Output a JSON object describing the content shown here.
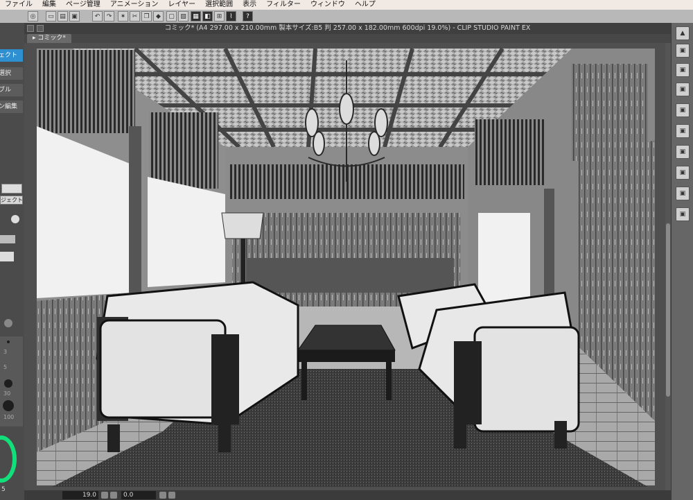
{
  "menubar": {
    "items": [
      "ファイル",
      "編集",
      "ページ管理",
      "アニメーション",
      "レイヤー",
      "選択範囲",
      "表示",
      "フィルター",
      "ウィンドウ",
      "ヘルプ"
    ]
  },
  "window": {
    "title": "コミック* (A4 297.00 x 210.00mm 製本サイズ:B5 判 257.00 x 182.00mm 600dpi 19.0%)  - CLIP STUDIO PAINT EX",
    "tab_label": "コミック*"
  },
  "toolbar": {
    "help_label": "?"
  },
  "left_panel": {
    "item1": "ェクト",
    "item2": "選択",
    "item3": "ブル",
    "item4": "ン編集",
    "field1": "ジェクト]",
    "brush_sizes": [
      "3",
      "5",
      "30",
      "100"
    ],
    "bottom_label": "5"
  },
  "status": {
    "zoom": "19.0",
    "angle": "0.0"
  },
  "colors": {
    "menubar_bg": "#f1e9e4",
    "accent_blue": "#2e8fd1",
    "color_wheel_green": "#11e07a",
    "canvas_bg": "#4f4f4f"
  }
}
